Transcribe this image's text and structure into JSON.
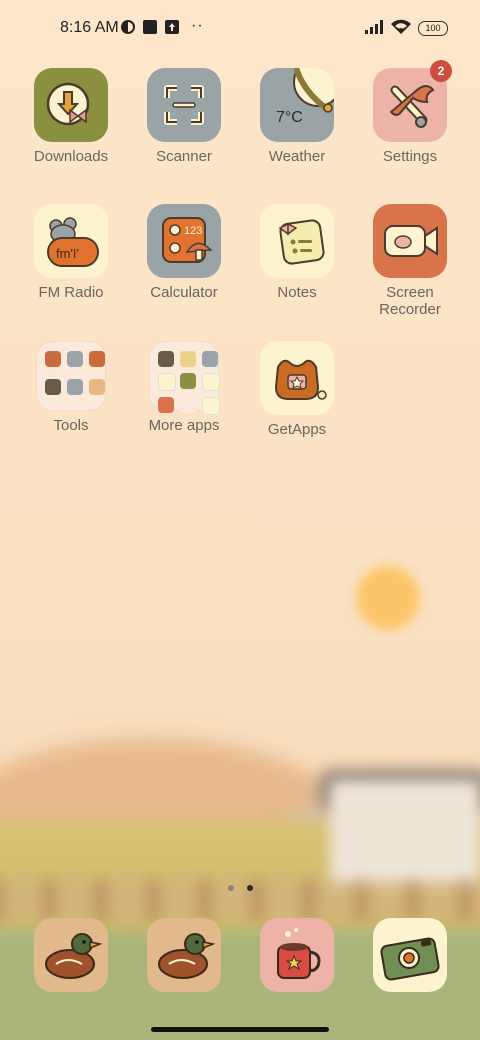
{
  "status_bar": {
    "time": "8:16 AM",
    "battery": "100",
    "icons": [
      "sync-icon",
      "square-icon",
      "upload-icon",
      "more-dots-icon",
      "signal-icon",
      "wifi-icon",
      "battery-icon"
    ],
    "more": "··"
  },
  "apps": [
    {
      "label": "Downloads",
      "icon": "downloads-icon",
      "bg": "#8a9040"
    },
    {
      "label": "Scanner",
      "icon": "scanner-icon",
      "bg": "#9aa3a6"
    },
    {
      "label": "Weather",
      "icon": "weather-icon",
      "bg": "#9aa3a6",
      "temp": "7°C"
    },
    {
      "label": "Settings",
      "icon": "settings-icon",
      "bg": "#eeb3a8",
      "badge": "2"
    },
    {
      "label": "FM Radio",
      "icon": "fm-radio-icon",
      "bg": "#fdf4cf",
      "text": "fm'I'"
    },
    {
      "label": "Calculator",
      "icon": "calculator-icon",
      "bg": "#9aa3a6",
      "text": "123"
    },
    {
      "label": "Notes",
      "icon": "notes-icon",
      "bg": "#fdf4cf"
    },
    {
      "label_line1": "Screen",
      "label_line2": "Recorder",
      "icon": "screen-recorder-icon",
      "bg": "#d9734a"
    },
    {
      "label": "Tools",
      "icon": "tools-folder-icon"
    },
    {
      "label": "More apps",
      "icon": "more-apps-folder-icon"
    },
    {
      "label": "GetApps",
      "icon": "getapps-icon",
      "bg": "#fdf4cf"
    }
  ],
  "folders": {
    "tools": [
      "#c96b3a",
      "#9aa3a6",
      "#c96b3a",
      "#6b5a4a",
      "#9aa3a6",
      "#e9b784"
    ],
    "more_apps": [
      "#6b5a4a",
      "#ebd28a",
      "#9aa3a6",
      "#fdf4cf",
      "#8a9040",
      "#fdf4cf",
      "#d9734a",
      "#fbeadb",
      "#fdf4cf"
    ]
  },
  "dock": [
    {
      "icon": "duck-icon",
      "bg": "#e2b98a"
    },
    {
      "icon": "duck-icon",
      "bg": "#e2b98a"
    },
    {
      "icon": "mug-icon",
      "bg": "#eeb3a8"
    },
    {
      "icon": "camera-icon",
      "bg": "#fdf4cf"
    }
  ],
  "pager": {
    "pages": 2,
    "current": 2
  }
}
